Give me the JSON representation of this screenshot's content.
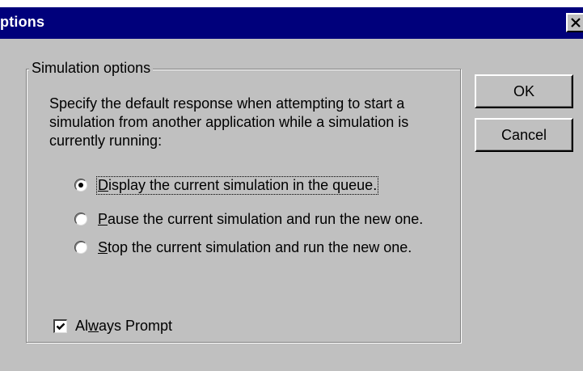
{
  "window": {
    "title": "ptions",
    "close_glyph": "close-icon"
  },
  "group": {
    "legend": "Simulation options",
    "description": "Specify the default response when attempting to start a simulation from another application while a simulation is currently running:"
  },
  "radios": [
    {
      "mnemonic": "D",
      "rest": "isplay the current simulation in the queue.",
      "selected": true
    },
    {
      "mnemonic": "P",
      "rest": "ause the current simulation and run the new one.",
      "selected": false
    },
    {
      "mnemonic": "S",
      "rest": "top the current simulation and run the new one.",
      "selected": false
    }
  ],
  "checkbox": {
    "before": "Al",
    "mnemonic": "w",
    "after": "ays Prompt",
    "checked": true
  },
  "buttons": {
    "ok_label": "OK",
    "cancel_label": "Cancel"
  },
  "colors": {
    "title_bar": "#00007b",
    "face": "#c0c0c0"
  }
}
